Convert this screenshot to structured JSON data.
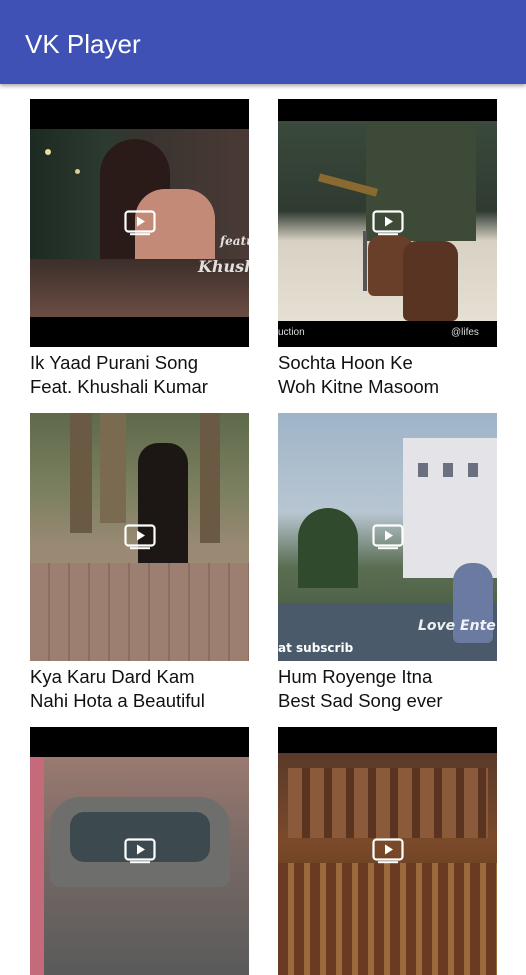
{
  "app": {
    "title": "VK Player"
  },
  "videos": [
    {
      "title_lines": [
        "Ik Yaad Purani Song",
        "Feat. Khushali Kumar"
      ],
      "overlay": "Khushali",
      "overlay_small": "featu"
    },
    {
      "title_lines": [
        "Sochta Hoon Ke",
        "Woh Kitne Masoom"
      ],
      "overlay": "@lifes",
      "overlay_small": "uction"
    },
    {
      "title_lines": [
        "Kya Karu Dard Kam",
        "Nahi Hota a Beautiful"
      ],
      "overlay": "",
      "overlay_small": ""
    },
    {
      "title_lines": [
        "Hum Royenge Itna",
        "Best Sad Song ever"
      ],
      "overlay": "Love Ente",
      "overlay_small": "at subscrib"
    },
    {
      "title_lines": [
        "",
        ""
      ],
      "overlay": "",
      "overlay_small": ""
    },
    {
      "title_lines": [
        "",
        ""
      ],
      "overlay": "",
      "overlay_small": ""
    }
  ],
  "icons": {
    "play": "play-video-icon"
  },
  "colors": {
    "appbar": "#3f51b5",
    "title_text": "#ffffff",
    "caption_text": "#111111"
  }
}
